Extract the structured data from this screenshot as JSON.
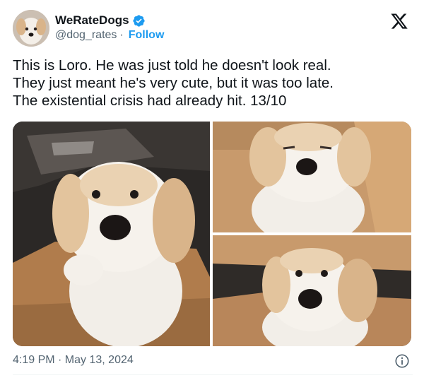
{
  "tweet": {
    "author_name": "WeRateDogs",
    "handle": "@dog_rates",
    "separator": "·",
    "follow_label": "Follow",
    "text": "This is Loro. He was just told he doesn't look real.\nThey just meant he's very cute, but it was too late.\nThe existential crisis had already hit. 13/10",
    "timestamp": "4:19 PM · May 13, 2024"
  },
  "icons": {
    "verified": "verified-badge-icon",
    "logo": "x-logo-icon",
    "info": "info-icon"
  },
  "colors": {
    "accent": "#1d9bf0",
    "text": "#0f1419",
    "muted": "#536471"
  }
}
